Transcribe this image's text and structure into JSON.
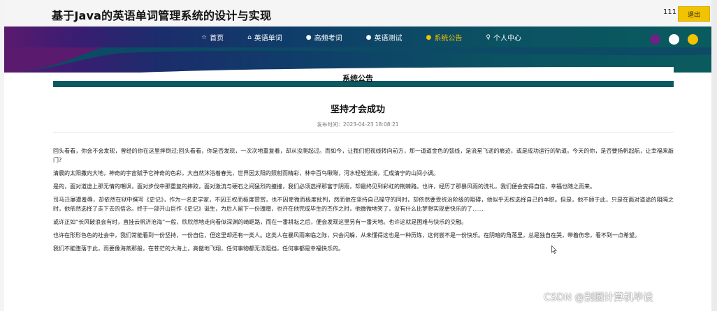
{
  "header": {
    "site_title": "基于Java的英语单词管理系统的设计与实现",
    "username": "111",
    "logout_label": "退出"
  },
  "nav": {
    "items": [
      {
        "icon": "☆",
        "label": "首页"
      },
      {
        "icon": "⌂",
        "label": "英语单词"
      },
      {
        "icon": "●",
        "label": "高频考词"
      },
      {
        "icon": "●",
        "label": "英语测试"
      },
      {
        "icon": "●",
        "label": "系统公告"
      },
      {
        "icon": "♀",
        "label": "个人中心"
      }
    ],
    "active_label": "系统公告",
    "theme_dots": [
      "#6a2483",
      "#ffffff",
      "#f2c300"
    ]
  },
  "section": {
    "title": "系统公告"
  },
  "article": {
    "title": "坚持才会成功",
    "publish_label": "发布时间：",
    "publish_time": "2023-04-23 18:08:21",
    "paragraphs": [
      "回头看看，你会不会发现，曾经的你在这里摔倒过;回头看看，你是否发现，一次次地重复着，却从没爬起过。而如今，让我们把视线转向前方，那一道道金色的弧线，是流星飞逝的痕迹，或是成功运行的轨道。今天的你，是否要扬帆起航，让幸福来敲门?",
      "清晨的太阳撒向大地，神奇的宇宙赋予它神奇的色彩，大自然沐浴着春光，世界因太阳的照射而精彩，林中百鸟啾啾，河水轻轻流淌，汇成清宁的山间小调。",
      "是的，面对道途上那无情的嘲讽，面对步伐中那重复的摔跤，面对激流与硬石之间猛烈的撞撞，我们必须选择那富于阴雨，却最终见到彩虹的荆棘路。也许，经历了那暴风雨的洗礼，我们便会变得自信，幸福也随之而来。",
      "司马迁屡遭羞辱，却依然在狱中撰写《史记》，作为一名史学家，不因王权而极度赞赏，也不因卑微而极度批判，然而他在坚持自己操守的同时，却依然要受统治阶级的阻碍，他似乎无权选择自己的本职。但是，他不顾于此，只是在面对道途的阻隔之时，他依然选择了走下去的信念。终于一部开山巨作《史记》诞生，为后人留下一份瑰赠，也许在他完成毕生的杰作之时，他微微地笑了，没有什么比梦想实现更快乐的了……",
      "或许正如“长风破浪会有时，直挂云帆济沧海”一般，欣欣然地走向看似深渊的崎岖路，而在一番耕耘之后，便会发现这里另有一番天地。也许这就是困难与快乐的交融。",
      "也许在形形色色的社会中，我们常能看到一份坚持，一份自信，但这里却还有一类人。这类人在暴风雨来临之际，只会闪躲，从未懂得这也是一种历炼，这何尝不是一份快乐。在阴暗的角落里，总是独自在哭，带着伤悲，看不到一点希望。",
      "我们不能堕落于此，而要像海燕那般，在苍茫的大海上，高傲地飞翔，任何事物都无法阻挡，任何事都是幸福快乐的。"
    ]
  },
  "watermark": "CSDN @别圆计算机毕设"
}
